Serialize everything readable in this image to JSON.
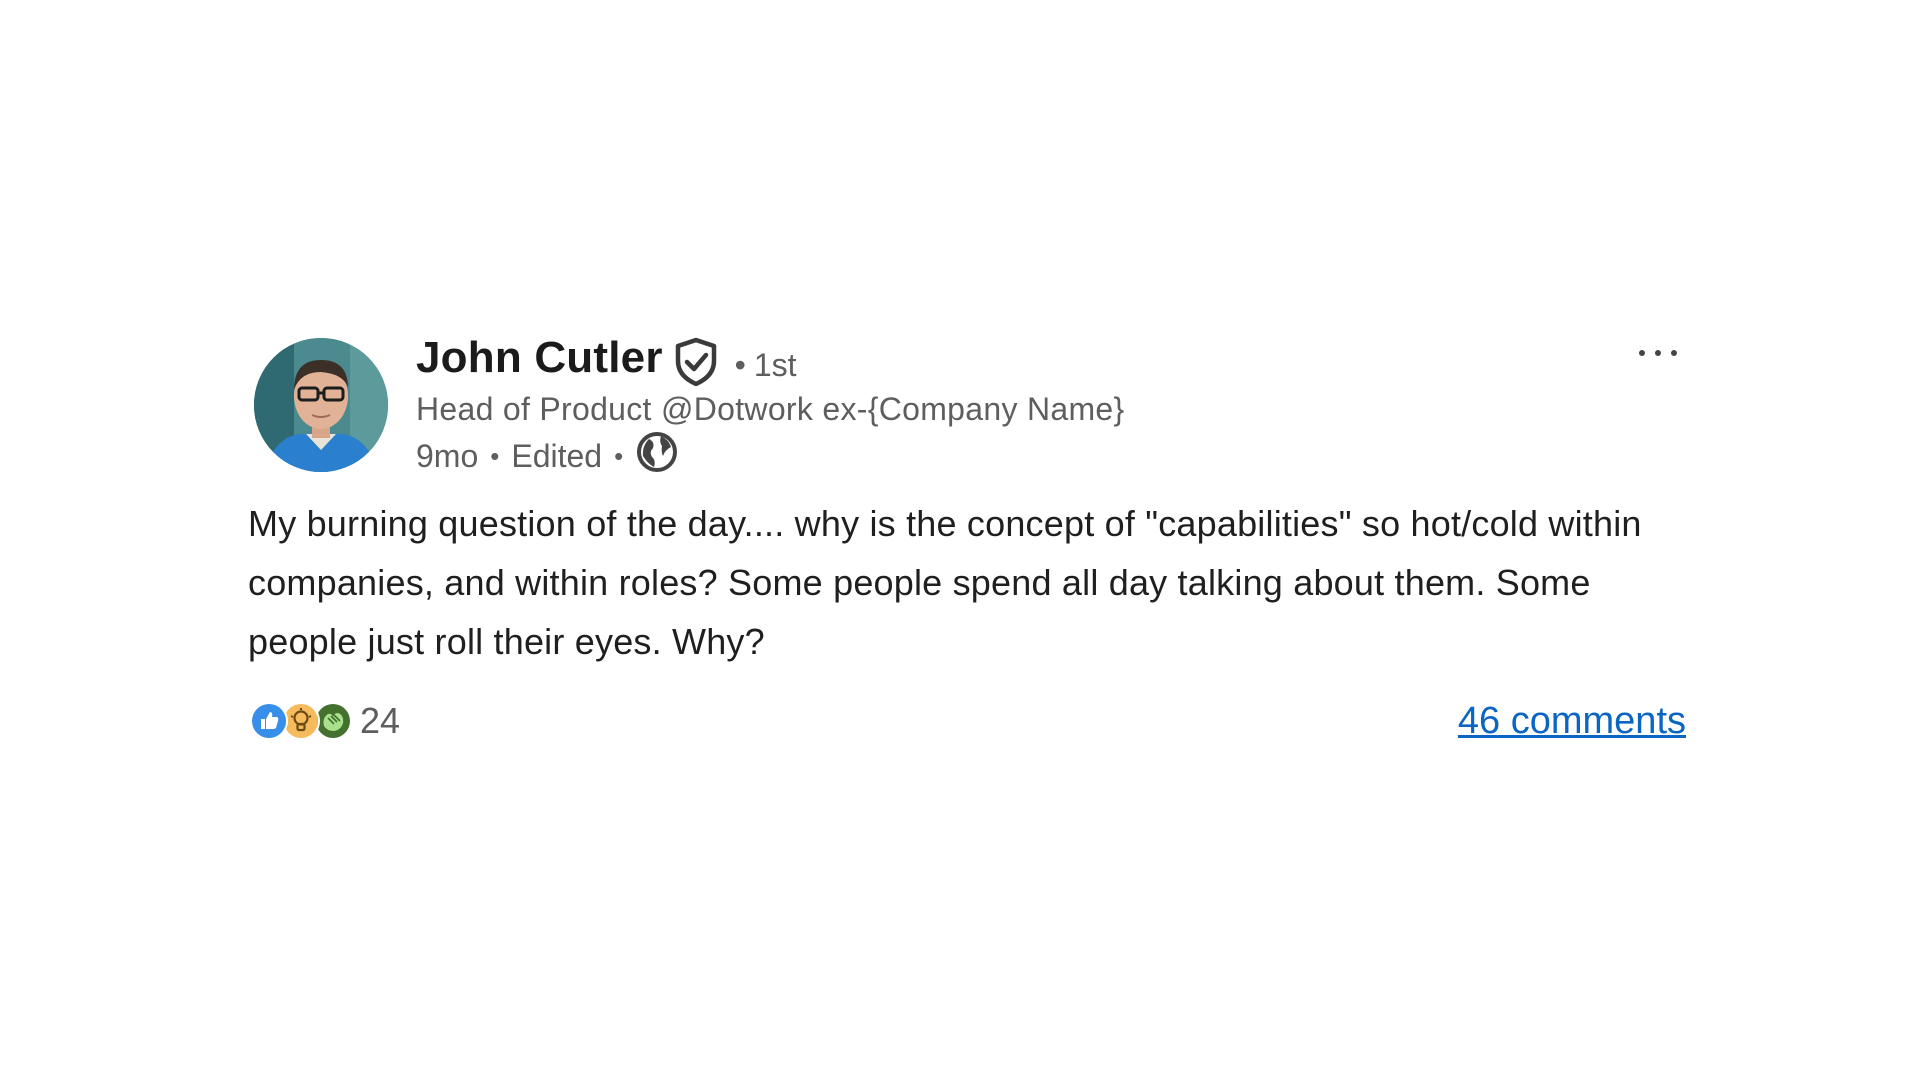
{
  "author": {
    "name": "John Cutler",
    "degree_dot": "•",
    "degree": "1st",
    "headline": "Head of Product @Dotwork ex-{Company Name}",
    "verified_icon": "verified-shield-icon"
  },
  "meta": {
    "time": "9mo",
    "separator": "•",
    "edited": "Edited",
    "visibility_icon": "globe-icon"
  },
  "menu_icon": "more-options-icon",
  "post": {
    "text": "My burning question of the day.... why is the concept of \"capabilities\" so hot/cold within companies, and within roles? Some people spend all day talking about them. Some people just roll their eyes. Why?"
  },
  "social": {
    "reactions": [
      {
        "name": "like-reaction-icon",
        "color": "#378fe9"
      },
      {
        "name": "insightful-reaction-icon",
        "color": "#f5bb5c"
      },
      {
        "name": "celebrate-reaction-icon",
        "color": "#44712e"
      }
    ],
    "reaction_count": "24",
    "comments": "46 comments"
  },
  "colors": {
    "text_primary": "#1f1f1f",
    "text_secondary": "#5e5e5e",
    "link": "#0a66c2"
  }
}
